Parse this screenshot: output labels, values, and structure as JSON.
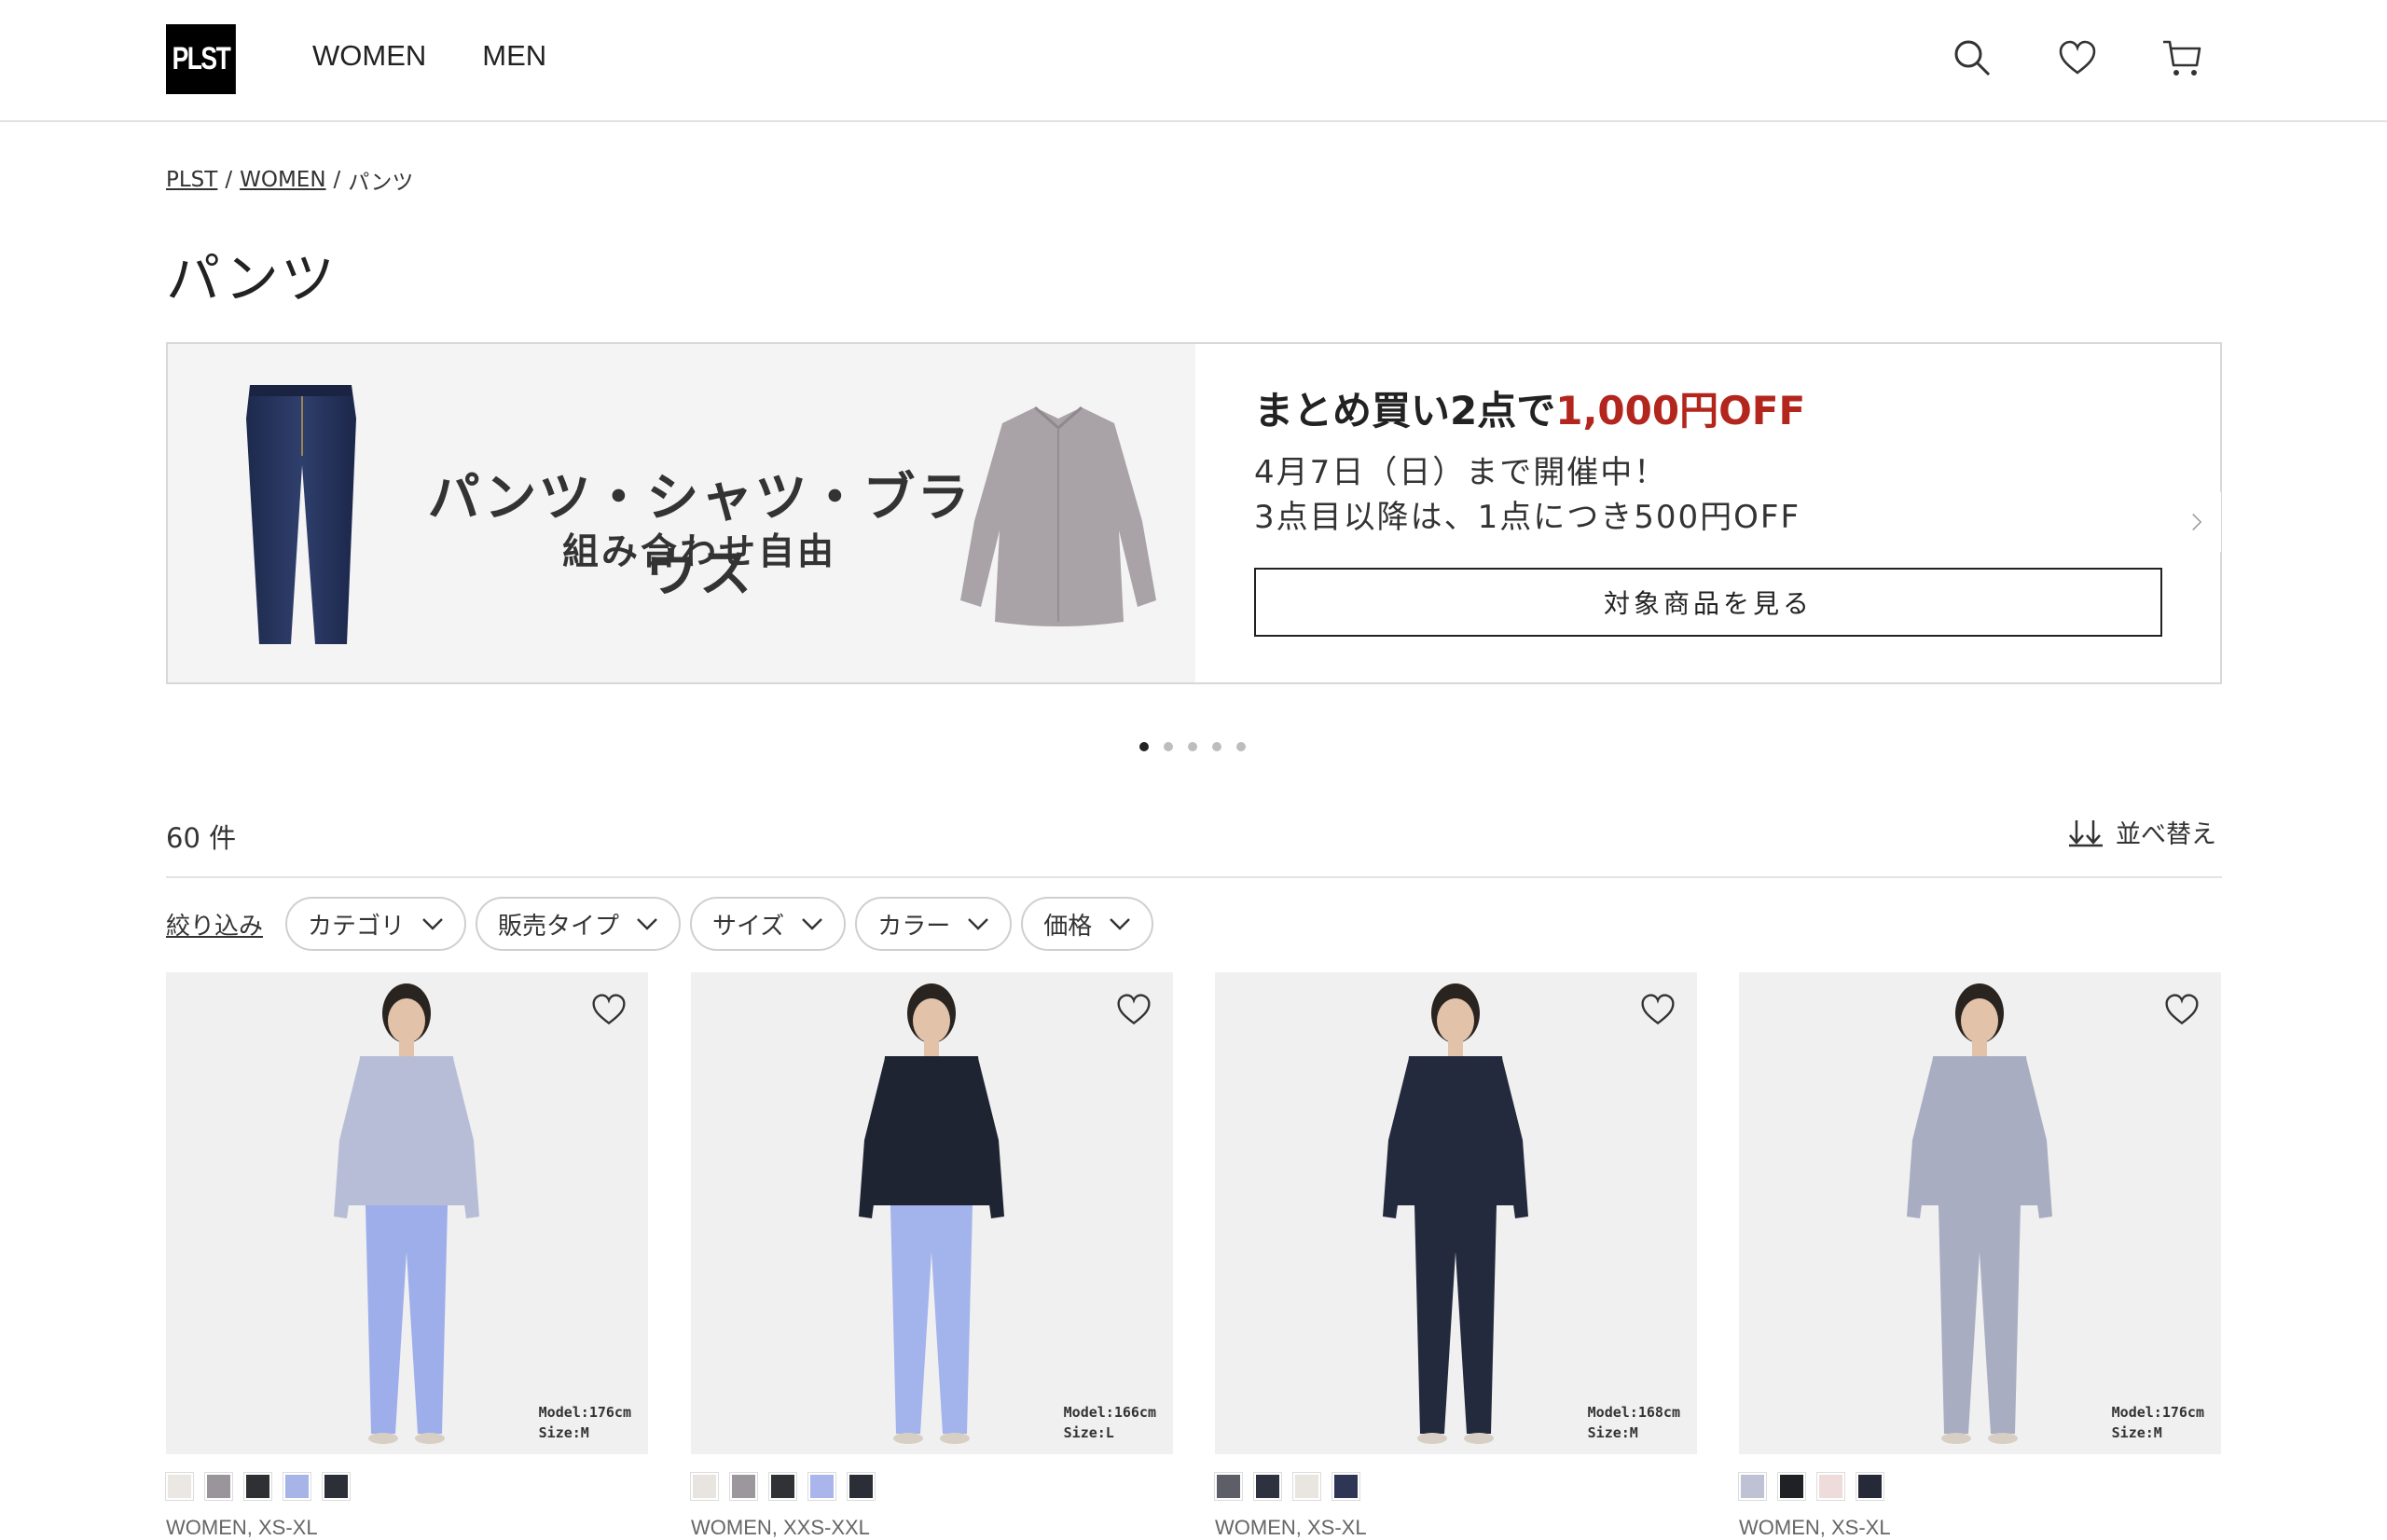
{
  "header": {
    "logo": "PLST",
    "nav": [
      "WOMEN",
      "MEN"
    ]
  },
  "breadcrumb": {
    "home": "PLST",
    "section": "WOMEN",
    "current": "パンツ",
    "separator": "/"
  },
  "page_title": "パンツ",
  "banner": {
    "headline": "パンツ・シャツ・ブラウス",
    "sub": "組み合わせ自由",
    "offer_prefix": "まとめ買い2点で",
    "offer_highlight": "1,000円OFF",
    "period": "4月7日（日）まで開催中！",
    "detail": "3点目以降は、1点につき500円OFF",
    "button": "対象商品を見る",
    "slide_count": 5,
    "active_slide": 1
  },
  "results": {
    "count": "60 件",
    "sort_label": "並べ替え"
  },
  "filters": {
    "label": "絞り込み",
    "chips": [
      "カテゴリ",
      "販売タイプ",
      "サイズ",
      "カラー",
      "価格"
    ]
  },
  "products": [
    {
      "model": "Model:176cm",
      "size": "Size:M",
      "meta": "WOMEN, XS-XL",
      "swatches": [
        "#ebe7e3",
        "#99959a",
        "#2f3033",
        "#a7b4e8",
        "#2c2e38"
      ],
      "top": "#b7bdd6",
      "bottom": "#9eaeea"
    },
    {
      "model": "Model:166cm",
      "size": "Size:L",
      "meta": "WOMEN, XXS-XXL",
      "swatches": [
        "#e8e4e0",
        "#9b979c",
        "#313236",
        "#a9b5eb",
        "#2b2d37"
      ],
      "top": "#1f2433",
      "bottom": "#a3b3ec"
    },
    {
      "model": "Model:168cm",
      "size": "Size:M",
      "meta": "WOMEN, XS-XL",
      "swatches": [
        "#5d5e68",
        "#2e3140",
        "#e9e5df",
        "#2f3655"
      ],
      "top": "#242a3d",
      "bottom": "#242a3d"
    },
    {
      "model": "Model:176cm",
      "size": "Size:M",
      "meta": "WOMEN, XS-XL",
      "swatches": [
        "#bfc1d4",
        "#1f2124",
        "#eddcda",
        "#262a38"
      ],
      "top": "#a8adc2",
      "bottom": "#a8adc2"
    }
  ],
  "colors": {
    "accent_red": "#b3261e",
    "text": "#222222",
    "border": "#d8d8d8"
  },
  "icons": [
    "search-icon",
    "heart-icon",
    "cart-icon",
    "sort-icon",
    "chevron-down-icon",
    "chevron-right-icon"
  ]
}
